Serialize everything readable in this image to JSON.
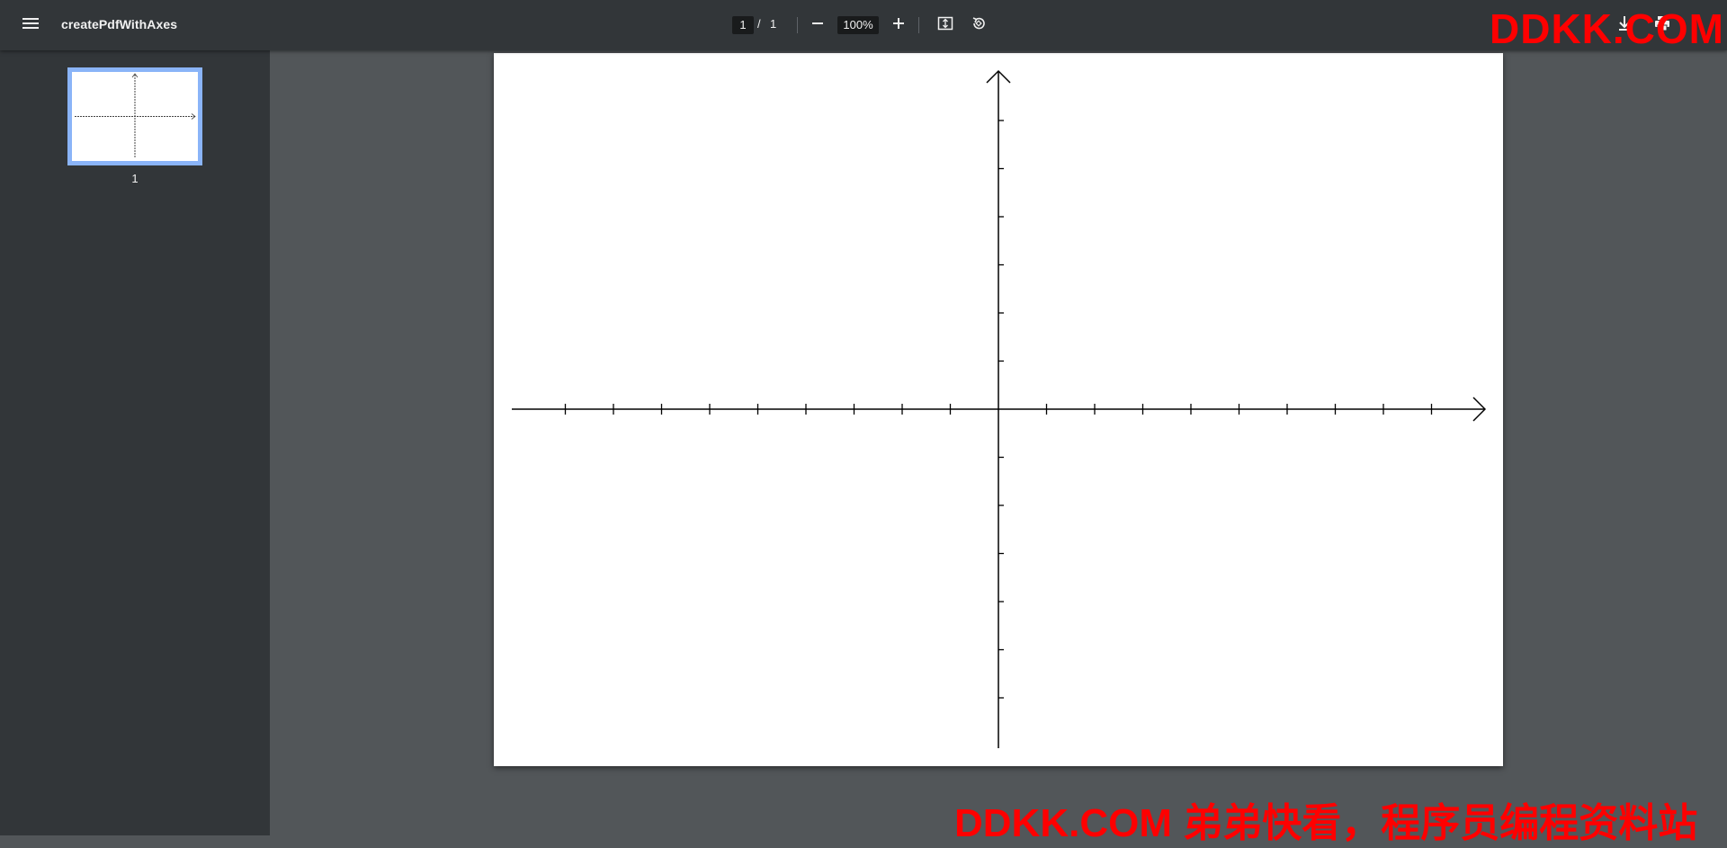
{
  "toolbar": {
    "title": "createPdfWithAxes",
    "page_current": "1",
    "page_separator": "/",
    "page_total": "1",
    "zoom": "100%",
    "icons": {
      "menu": "menu-icon",
      "zoom_out": "minus-icon",
      "zoom_in": "plus-icon",
      "fit": "fit-to-page-icon",
      "rotate": "rotate-icon",
      "download": "download-icon",
      "print": "print-icon",
      "more": "more-icon"
    }
  },
  "sidebar": {
    "thumbnails": [
      {
        "label": "1",
        "selected": true
      }
    ]
  },
  "document": {
    "figure": "coordinate axes with arrowheads and tick marks",
    "x_ticks_left": 9,
    "x_ticks_right": 9,
    "y_ticks_up": 6,
    "y_ticks_down": 6
  },
  "watermarks": {
    "top": "DDKK.COM",
    "bottom": "DDKK.COM 弟弟快看，程序员编程资料站"
  },
  "colors": {
    "toolbar_bg": "#323639",
    "viewer_bg": "#525659",
    "selected_thumb_border": "#8ab4f8",
    "watermark": "#ff0000"
  }
}
